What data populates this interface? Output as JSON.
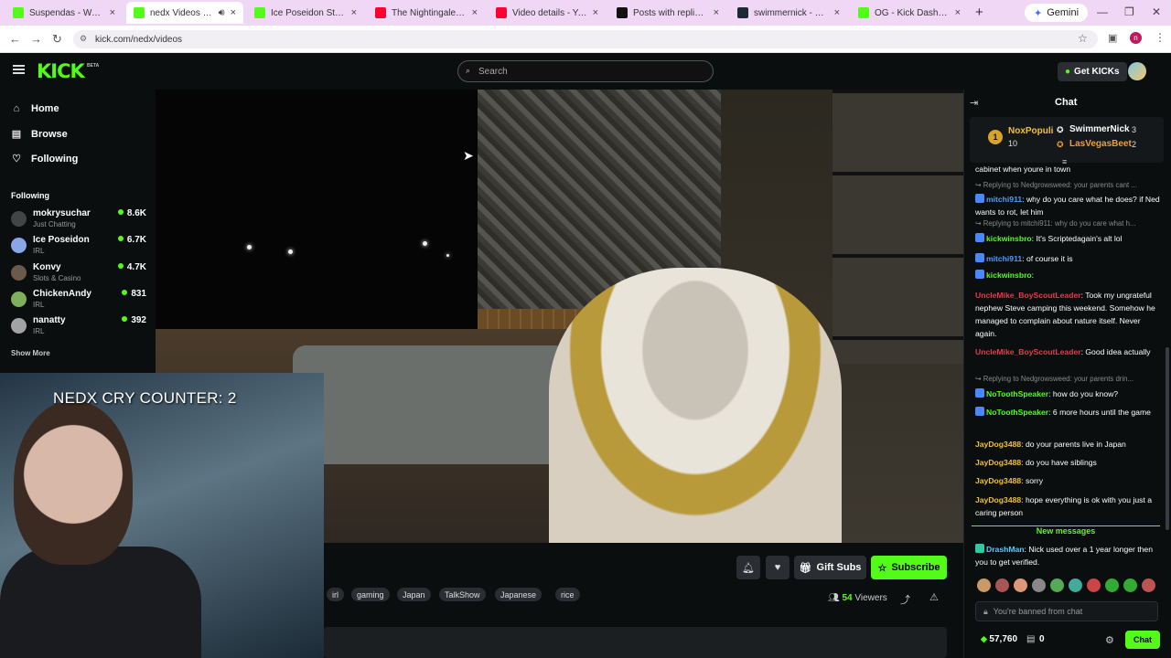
{
  "browser": {
    "tabs": [
      {
        "title": "Suspendas - Watch the",
        "color": "#53fc18"
      },
      {
        "title": "nedx Videos - Watc",
        "color": "#53fc18"
      },
      {
        "title": "Ice Poseidon Stream - V",
        "color": "#53fc18"
      },
      {
        "title": "The Nightingale - YouT",
        "color": "#ff0033"
      },
      {
        "title": "Video details - YouTube",
        "color": "#ff0033"
      },
      {
        "title": "Posts with replies by Ti",
        "color": "#111111"
      },
      {
        "title": "swimmernick - streame",
        "color": "#1b2a36"
      },
      {
        "title": "OG - Kick Dashboard",
        "color": "#53fc18"
      }
    ],
    "new_tab": "+",
    "gemini_label": "Gemini",
    "url": "kick.com/nedx/videos",
    "profile_initial": "n"
  },
  "header": {
    "logo": "KICK",
    "beta": "BETA",
    "search_placeholder": "Search",
    "get_kicks": "Get KICKs"
  },
  "sidebar": {
    "nav": [
      {
        "label": "Home",
        "icon": "home-icon",
        "glyph": "⌂"
      },
      {
        "label": "Browse",
        "icon": "browse-icon",
        "glyph": "▤"
      },
      {
        "label": "Following",
        "icon": "heart-icon",
        "glyph": "♡"
      }
    ],
    "following_header": "Following",
    "following": [
      {
        "name": "mokrysuchar",
        "category": "Just Chatting",
        "viewers": "8.6K",
        "color": "#444"
      },
      {
        "name": "Ice Poseidon",
        "category": "IRL",
        "viewers": "6.7K",
        "color": "#8aa6e6"
      },
      {
        "name": "Konvy",
        "category": "Slots & Casino",
        "viewers": "4.7K",
        "color": "#6b5a4a"
      },
      {
        "name": "ChickenAndy",
        "category": "IRL",
        "viewers": "831",
        "color": "#7fae5c"
      },
      {
        "name": "nanatty",
        "category": "IRL",
        "viewers": "392",
        "color": "#a3a3a3"
      }
    ],
    "show_more": "Show More"
  },
  "overlay": {
    "cry_counter": "NEDX CRY COUNTER: 2"
  },
  "stream": {
    "tags": [
      "irl",
      "gaming",
      "Japan",
      "TalkShow",
      "Japanese",
      "rice"
    ],
    "gift_subs": "Gift Subs",
    "subscribe": "Subscribe",
    "viewers_count": "54",
    "viewers_label": "Viewers"
  },
  "chat": {
    "title": "Chat",
    "pinned": {
      "rank": "1",
      "top_gifter": "NoxPopuli",
      "top_gifter_count": "10",
      "gifters": [
        {
          "name": "SwimmerNick",
          "count": "3",
          "color": "#ffffff"
        },
        {
          "name": "LasVegasBeet",
          "count": "2",
          "color": "#f0a030"
        }
      ]
    },
    "messages": [
      {
        "type": "text",
        "user": "",
        "text": "cabinet when youre in town",
        "color": "#fff"
      },
      {
        "type": "reply",
        "text": "Replying to Nedgrowsweed: your parents cant ..."
      },
      {
        "type": "text",
        "user": "mitchi911",
        "text": ": why do you care what he does? if Ned wants to rot, let him",
        "color": "#4a9cff",
        "badge": true
      },
      {
        "type": "reply",
        "text": "Replying to mitchi911: why do you care what h..."
      },
      {
        "type": "text",
        "user": "kickwinsbro",
        "text": ": It's Scriptedagain's alt lol",
        "color": "#53fc18",
        "badge": true
      },
      {
        "type": "text",
        "user": "mitchi911",
        "text": ": of course it is",
        "color": "#4a9cff",
        "badge": true
      },
      {
        "type": "text",
        "user": "kickwinsbro",
        "text": ":",
        "color": "#53fc18",
        "badge": true
      },
      {
        "type": "text",
        "user": "UncleMike_BoyScoutLeader",
        "text": ": Took my ungrateful nephew Steve camping this weekend. Somehow he managed to complain about nature itself. Never again.",
        "color": "#e83a4a"
      },
      {
        "type": "text",
        "user": "UncleMike_BoyScoutLeader",
        "text": ": Good idea actually",
        "color": "#e83a4a"
      },
      {
        "type": "reply",
        "text": "Replying to Nedgrowsweed: your parents drin..."
      },
      {
        "type": "text",
        "user": "NoToothSpeaker",
        "text": ": how do you know?",
        "color": "#53fc18",
        "badge": true
      },
      {
        "type": "text",
        "user": "NoToothSpeaker",
        "text": ": 6 more hours until the game",
        "color": "#53fc18",
        "badge": true
      },
      {
        "type": "text",
        "user": "JayDog3488",
        "text": ": do your parents live in Japan",
        "color": "#f0c030"
      },
      {
        "type": "text",
        "user": "JayDog3488",
        "text": ": do you have siblings",
        "color": "#f0c030"
      },
      {
        "type": "text",
        "user": "JayDog3488",
        "text": ": sorry",
        "color": "#f0c030"
      },
      {
        "type": "text",
        "user": "JayDog3488",
        "text": ": hope everything is ok with you just a caring person",
        "color": "#f0c030"
      }
    ],
    "new_messages": "New messages",
    "after": {
      "user": "DrashMan",
      "text": ": Nick used over a 1 year longer then you to get verified.",
      "color": "#4ad0ff"
    },
    "banned_placeholder": "You're banned from chat",
    "kicks_balance": "57,760",
    "gift_count": "0",
    "chat_button": "Chat"
  }
}
